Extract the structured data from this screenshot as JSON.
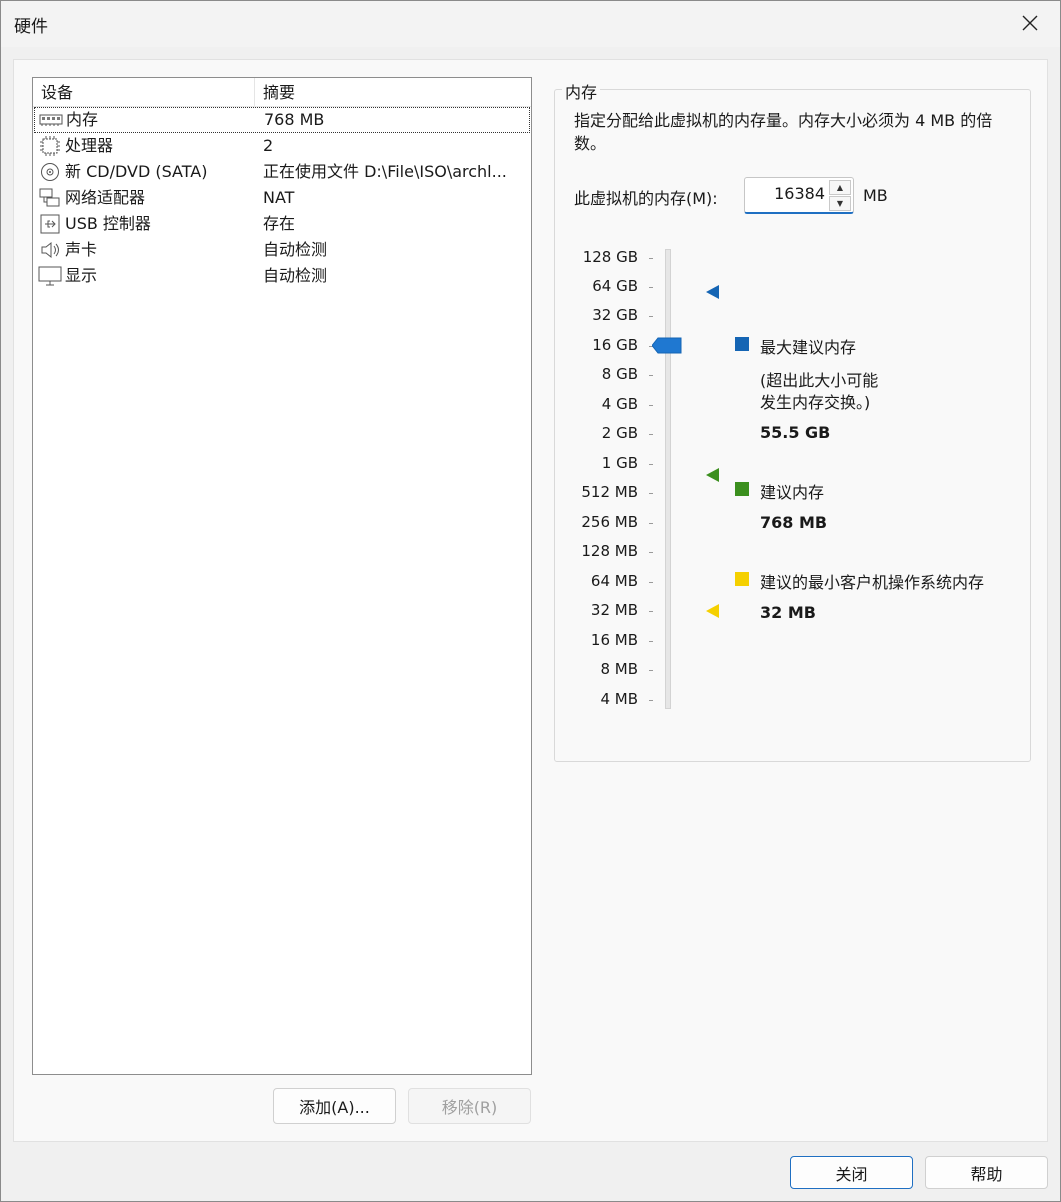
{
  "window": {
    "title": "硬件"
  },
  "device_list": {
    "columns": [
      "设备",
      "摘要"
    ],
    "rows": [
      {
        "icon": "memory-icon",
        "name": "内存",
        "summary": "768 MB"
      },
      {
        "icon": "processor-icon",
        "name": "处理器",
        "summary": "2"
      },
      {
        "icon": "cd-dvd-icon",
        "name": "新 CD/DVD (SATA)",
        "summary": "正在使用文件 D:\\File\\ISO\\archl..."
      },
      {
        "icon": "network-adapter-icon",
        "name": "网络适配器",
        "summary": "NAT"
      },
      {
        "icon": "usb-icon",
        "name": "USB 控制器",
        "summary": "存在"
      },
      {
        "icon": "sound-icon",
        "name": "声卡",
        "summary": "自动检测"
      },
      {
        "icon": "display-icon",
        "name": "显示",
        "summary": "自动检测"
      }
    ]
  },
  "buttons": {
    "add": "添加(A)...",
    "remove": "移除(R)",
    "close": "关闭",
    "help": "帮助"
  },
  "memory": {
    "group_title": "内存",
    "description": "指定分配给此虚拟机的内存量。内存大小必须为 4 MB 的倍数。",
    "field_label": "此虚拟机的内存(M):",
    "value": "16384",
    "unit": "MB",
    "scale_labels": [
      "128 GB",
      "64 GB",
      "32 GB",
      "16 GB",
      "8 GB",
      "4 GB",
      "2 GB",
      "1 GB",
      "512 MB",
      "256 MB",
      "128 MB",
      "64 MB",
      "32 MB",
      "16 MB",
      "8 MB",
      "4 MB"
    ],
    "current_level_label": "16 GB",
    "legend": {
      "max": {
        "label": "最大建议内存",
        "note_line1": "(超出此大小可能",
        "note_line2": "发生内存交换。)",
        "value": "55.5 GB",
        "color": "#1565b4"
      },
      "recommended": {
        "label": "建议内存",
        "value": "768 MB",
        "color": "#3b8f1e"
      },
      "min": {
        "label": "建议的最小客户机操作系统内存",
        "value": "32 MB",
        "color": "#f5d000"
      }
    },
    "thumb_color": "#1f78d1"
  }
}
